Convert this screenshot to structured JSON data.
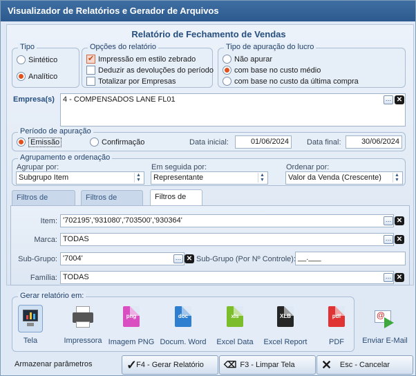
{
  "window": {
    "title": "Visualizador de Relatórios e Gerador de Arquivos"
  },
  "report": {
    "title": "Relatório de Fechamento de Vendas"
  },
  "tipo": {
    "legend": "Tipo",
    "options": [
      {
        "label": "Sintético",
        "selected": false
      },
      {
        "label": "Analítico",
        "selected": true
      }
    ]
  },
  "opcoes": {
    "legend": "Opções do relatório",
    "items": [
      {
        "label": "Impressão em estilo zebrado",
        "checked": true
      },
      {
        "label": "Deduzir as devoluções do período",
        "checked": false
      },
      {
        "label": "Totalizar por Empresas",
        "checked": false
      }
    ]
  },
  "apuracao_lucro": {
    "legend": "Tipo de apuração do lucro",
    "options": [
      {
        "label": "Não apurar",
        "selected": false
      },
      {
        "label": "com base no custo médio",
        "selected": true
      },
      {
        "label": "com base no custo da última compra",
        "selected": false
      }
    ]
  },
  "empresas": {
    "label": "Empresa(s)",
    "value": "4 - COMPENSADOS LANE FL01"
  },
  "periodo": {
    "legend": "Período de apuração",
    "options": [
      {
        "label": "Emissão",
        "selected": true
      },
      {
        "label": "Confirmação",
        "selected": false
      }
    ],
    "start_label": "Data inicial:",
    "start_value": "01/06/2024",
    "end_label": "Data final:",
    "end_value": "30/06/2024"
  },
  "agrupamento": {
    "legend": "Agrupamento e ordenação",
    "agrupar_label": "Agrupar por:",
    "agrupar_value": "Subgrupo Item",
    "seguida_label": "Em seguida por:",
    "seguida_value": "Representante",
    "ordenar_label": "Ordenar por:",
    "ordenar_value": "Valor da Venda (Crescente)"
  },
  "tabs": [
    {
      "label": "Filtros de venda",
      "active": false
    },
    {
      "label": "Filtros de cliente",
      "active": false
    },
    {
      "label": "Filtros de item",
      "active": true
    }
  ],
  "filters": {
    "item_label": "Item:",
    "item_value": "'702195','931080','703500','930364'",
    "marca_label": "Marca:",
    "marca_value": "TODAS",
    "subgrupo_label": "Sub-Grupo:",
    "subgrupo_value": "'7004'",
    "subgrupo_ctrl_label": "Sub-Grupo (Por Nº Controle):",
    "subgrupo_ctrl_value": "__.___",
    "familia_label": "Família:",
    "familia_value": "TODAS"
  },
  "output": {
    "legend": "Gerar relatório em:",
    "items": [
      {
        "label": "Tela",
        "icon": "monitor-icon"
      },
      {
        "label": "Impressora",
        "icon": "printer-icon"
      },
      {
        "label": "Imagem PNG",
        "icon": "png-file-icon",
        "badge": "png",
        "color": "#d94fc2"
      },
      {
        "label": "Docum. Word",
        "icon": "word-file-icon",
        "badge": "doc",
        "color": "#2f7fd1"
      },
      {
        "label": "Excel Data",
        "icon": "xls-file-icon",
        "badge": "xls",
        "color": "#7cbd2b"
      },
      {
        "label": "Excel Report",
        "icon": "xlb-file-icon",
        "badge": "XLB",
        "color": "#262626"
      },
      {
        "label": "PDF",
        "icon": "pdf-file-icon",
        "badge": "pdf",
        "color": "#e03434"
      }
    ],
    "email_label": "Enviar E-Mail"
  },
  "footer": {
    "store_params": "Armazenar parâmetros",
    "generate": "F4 - Gerar Relatório",
    "clear": "F3 - Limpar Tela",
    "cancel": "Esc - Cancelar"
  }
}
